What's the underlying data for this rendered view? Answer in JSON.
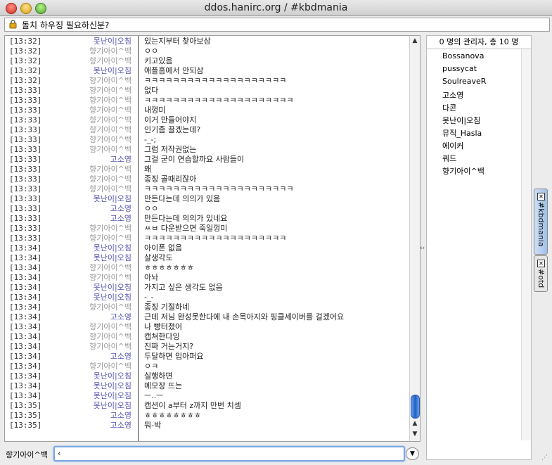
{
  "window": {
    "title": "ddos.hanirc.org / #kbdmania"
  },
  "topic": {
    "text": "돌치 하우징 필요하신분?",
    "icon": "lock-icon"
  },
  "colors": {
    "own_nick": "#5555b0",
    "other_nick": "#9a9a9a",
    "accent": "#7aa7e6"
  },
  "chat": {
    "lines": [
      {
        "time": "[13:32]",
        "nick": "못난이|오침",
        "color": "#5555b0",
        "msg": "있는지부터 찾아보삼"
      },
      {
        "time": "[13:32]",
        "nick": "향기아이^백",
        "color": "#9a9a9a",
        "msg": "ㅇㅇ"
      },
      {
        "time": "[13:32]",
        "nick": "향기아이^백",
        "color": "#9a9a9a",
        "msg": "키고있음"
      },
      {
        "time": "[13:32]",
        "nick": "못난이|오침",
        "color": "#5555b0",
        "msg": "애플홈에서 안되삼"
      },
      {
        "time": "[13:32]",
        "nick": "향기아이^백",
        "color": "#9a9a9a",
        "msg": "ㅋㅋㅋㅋㅋㅋㅋㅋㅋㅋㅋㅋㅋㅋㅋㅋㅋㅋㅋㅋ"
      },
      {
        "time": "[13:33]",
        "nick": "향기아이^백",
        "color": "#9a9a9a",
        "msg": "없다"
      },
      {
        "time": "[13:33]",
        "nick": "향기아이^백",
        "color": "#9a9a9a",
        "msg": "ㅋㅋㅋㅋㅋㅋㅋㅋㅋㅋㅋㅋㅋㅋㅋㅋㅋㅋㅋㅋㅋ"
      },
      {
        "time": "[13:33]",
        "nick": "향기아이^백",
        "color": "#9a9a9a",
        "msg": "내껑미"
      },
      {
        "time": "[13:33]",
        "nick": "향기아이^백",
        "color": "#9a9a9a",
        "msg": "이거 만들어야지"
      },
      {
        "time": "[13:33]",
        "nick": "향기아이^백",
        "color": "#9a9a9a",
        "msg": "인기좀 끌겠는데?"
      },
      {
        "time": "[13:33]",
        "nick": "향기아이^백",
        "color": "#9a9a9a",
        "msg": "-_-;"
      },
      {
        "time": "[13:33]",
        "nick": "향기아이^백",
        "color": "#9a9a9a",
        "msg": "그럼 저작권없는"
      },
      {
        "time": "[13:33]",
        "nick": "고소영",
        "color": "#5555b0",
        "msg": "그걸 굳이 연습할까요 사람들이"
      },
      {
        "time": "[13:33]",
        "nick": "향기아이^백",
        "color": "#9a9a9a",
        "msg": "왜"
      },
      {
        "time": "[13:33]",
        "nick": "향기아이^백",
        "color": "#9a9a9a",
        "msg": "종징 골때리잖아"
      },
      {
        "time": "[13:33]",
        "nick": "향기아이^백",
        "color": "#9a9a9a",
        "msg": "ㅋㅋㅋㅋㅋㅋㅋㅋㅋㅋㅋㅋㅋㅋㅋㅋㅋㅋㅋㅋㅋ"
      },
      {
        "time": "[13:33]",
        "nick": "못난이|오침",
        "color": "#5555b0",
        "msg": "만든다는데 의의가 있음"
      },
      {
        "time": "[13:33]",
        "nick": "고소영",
        "color": "#5555b0",
        "msg": "ㅇㅇ"
      },
      {
        "time": "[13:33]",
        "nick": "고소영",
        "color": "#5555b0",
        "msg": "만든다는데 의의가 있네요"
      },
      {
        "time": "[13:33]",
        "nick": "향기아이^백",
        "color": "#9a9a9a",
        "msg": "ㅆㅂ 다운받으면 죽일껑미"
      },
      {
        "time": "[13:33]",
        "nick": "향기아이^백",
        "color": "#9a9a9a",
        "msg": "ㅋㅋㅋㅋㅋㅋㅋㅋㅋㅋㅋㅋㅋㅋㅋㅋㅋㅋㅋㅋ"
      },
      {
        "time": "[13:34]",
        "nick": "못난이|오침",
        "color": "#5555b0",
        "msg": "아이폰 없음"
      },
      {
        "time": "[13:34]",
        "nick": "못난이|오침",
        "color": "#5555b0",
        "msg": "살생각도"
      },
      {
        "time": "[13:34]",
        "nick": "향기아이^백",
        "color": "#9a9a9a",
        "msg": "ㅎㅎㅎㅎㅎㅎㅎ"
      },
      {
        "time": "[13:34]",
        "nick": "향기아이^백",
        "color": "#9a9a9a",
        "msg": "아놔"
      },
      {
        "time": "[13:34]",
        "nick": "못난이|오침",
        "color": "#5555b0",
        "msg": "가지고 싶은 생각도 없음"
      },
      {
        "time": "[13:34]",
        "nick": "못난이|오침",
        "color": "#5555b0",
        "msg": "-_-"
      },
      {
        "time": "[13:34]",
        "nick": "향기아이^백",
        "color": "#9a9a9a",
        "msg": "종징 기절하네"
      },
      {
        "time": "[13:34]",
        "nick": "고소영",
        "color": "#5555b0",
        "msg": "근데 저님 완성못한다에 내 손목아지와 핑클세이버를 걸겠어요"
      },
      {
        "time": "[13:34]",
        "nick": "향기아이^백",
        "color": "#9a9a9a",
        "msg": "나 빵터졌어"
      },
      {
        "time": "[13:34]",
        "nick": "향기아이^백",
        "color": "#9a9a9a",
        "msg": "캡쳐한다잉"
      },
      {
        "time": "[13:34]",
        "nick": "향기아이^백",
        "color": "#9a9a9a",
        "msg": "진짜 거는거지?"
      },
      {
        "time": "[13:34]",
        "nick": "고소영",
        "color": "#5555b0",
        "msg": "두달하면 입아퍼요"
      },
      {
        "time": "[13:34]",
        "nick": "향기아이^백",
        "color": "#9a9a9a",
        "msg": "ㅇㅋ"
      },
      {
        "time": "[13:34]",
        "nick": "못난이|오침",
        "color": "#5555b0",
        "msg": "실행하면"
      },
      {
        "time": "[13:34]",
        "nick": "못난이|오침",
        "color": "#5555b0",
        "msg": "메모장 뜨는"
      },
      {
        "time": "[13:34]",
        "nick": "못난이|오침",
        "color": "#5555b0",
        "msg": "ㅡ..ㅡ"
      },
      {
        "time": "[13:35]",
        "nick": "못난이|오침",
        "color": "#5555b0",
        "msg": "캡션이 a부터 z까지 만번 치셈"
      },
      {
        "time": "[13:35]",
        "nick": "고소영",
        "color": "#5555b0",
        "msg": "ㅎㅎㅎㅎㅎㅎㅎㅎ"
      },
      {
        "time": "[13:35]",
        "nick": "고소영",
        "color": "#5555b0",
        "msg": "뭐-박"
      }
    ]
  },
  "userlist": {
    "header": "0 명의 관리자, 총 10 명",
    "users": [
      "Bossanova",
      "pussycat",
      "SoulreaveR",
      "고소영",
      "다콘",
      "못난이|오침",
      "뮤직_Hasla",
      "에이커",
      "쿼드",
      "향기아이^백"
    ]
  },
  "tabs": [
    {
      "label": "#kbdmania",
      "active": true
    },
    {
      "label": "#otd",
      "active": false
    }
  ],
  "input": {
    "nick": "향기아이^백",
    "value": "‹"
  }
}
